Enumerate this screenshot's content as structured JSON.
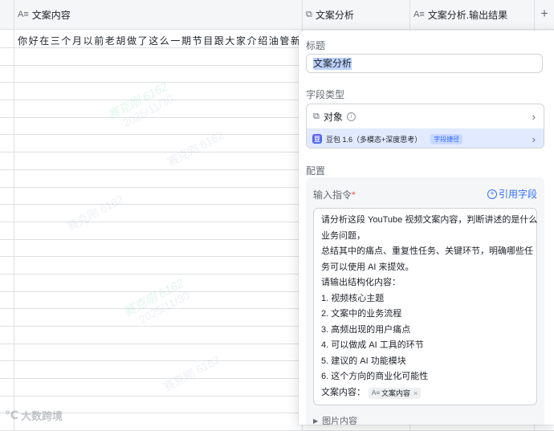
{
  "grid": {
    "columns": [
      {
        "icon": "A≡",
        "label": "文案内容"
      },
      {
        "icon": "⧉",
        "label": "文案分析"
      },
      {
        "icon": "A≡",
        "label": "文案分析.输出结果"
      }
    ],
    "add_column": "+",
    "first_row_text": "你好在三个月以前老胡做了这么一期节目跟大家介绍油管新..."
  },
  "panel": {
    "title_label": "标题",
    "title_value": "文案分析",
    "field_type_label": "字段类型",
    "field_type_value": "对象",
    "model_name": "豆包 1.6（多模态+深度思考）",
    "model_tag": "字段捷径",
    "config_label": "配置",
    "input_label": "输入指令",
    "required_mark": "*",
    "ref_field": "引用字段",
    "prompt_lines": [
      "请分析这段 YouTube 视频文案内容，判断讲述的是什么",
      "业务问题，",
      "总结其中的痛点、重复性任务、关键环节，明确哪些任",
      "务可以使用 AI 来提效。",
      "请输出结构化内容：",
      "1. 视频核心主题",
      "2. 文案中的业务流程",
      "3. 高频出现的用户痛点",
      "4. 可以做成 AI 工具的环节",
      "5. 建议的 AI 功能模块",
      "6. 这个方向的商业化可能性"
    ],
    "prompt_ref_label": "文案内容：",
    "prompt_ref_chip": "文案内容",
    "image_section": "图片内容"
  },
  "brand": "大数跨境",
  "watermarks": [
    "赛克刚 6162",
    "2025/11/30"
  ]
}
